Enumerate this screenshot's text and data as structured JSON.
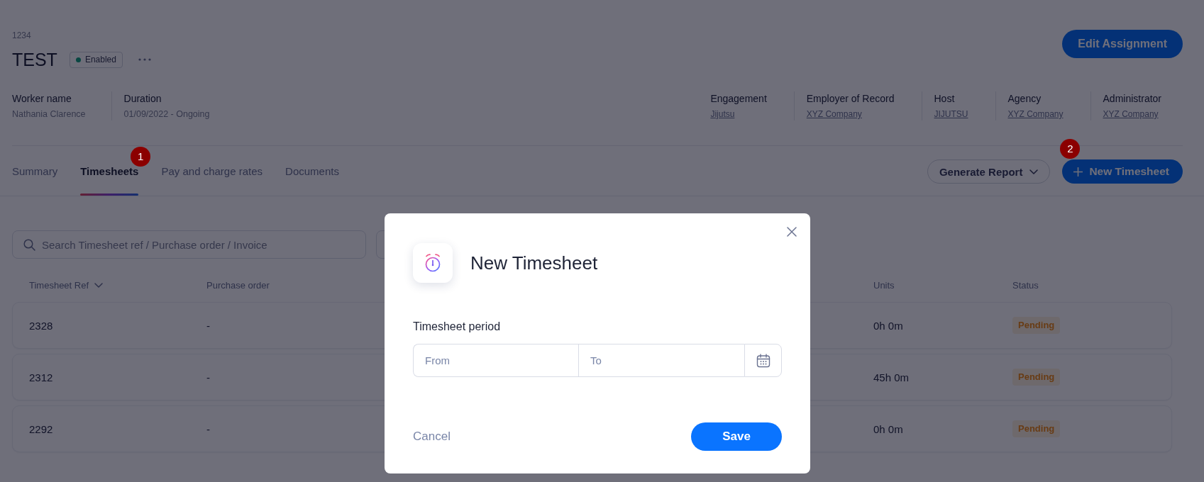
{
  "header": {
    "reference": "1234",
    "title": "TEST",
    "status": {
      "label": "Enabled",
      "on": true
    },
    "edit_button": "Edit Assignment"
  },
  "details": {
    "left": [
      {
        "label": "Worker name",
        "value": "Nathania Clarence",
        "kind": "text"
      },
      {
        "label": "Duration",
        "value": "01/09/2022 - Ongoing",
        "kind": "text"
      }
    ],
    "right": [
      {
        "label": "Engagement",
        "value": "Jijutsu",
        "kind": "link"
      },
      {
        "label": "Employer of Record",
        "value": "XYZ Company",
        "kind": "link"
      },
      {
        "label": "Host",
        "value": "JIJUTSU",
        "kind": "link"
      },
      {
        "label": "Agency",
        "value": "XYZ Company",
        "kind": "link"
      },
      {
        "label": "Administrator",
        "value": "XYZ Company",
        "kind": "link"
      }
    ]
  },
  "tabs": [
    {
      "label": "Summary",
      "selected": false
    },
    {
      "label": "Timesheets",
      "selected": true,
      "marker": "1"
    },
    {
      "label": "Pay and charge rates",
      "selected": false
    },
    {
      "label": "Documents",
      "selected": false
    }
  ],
  "actions": {
    "generate_report": "Generate Report",
    "new_timesheet": {
      "label": "New Timesheet",
      "marker": "2"
    }
  },
  "search": {
    "placeholder": "Search Timesheet ref / Purchase order / Invoice"
  },
  "table": {
    "columns": [
      {
        "label": "Timesheet Ref",
        "sorted": true
      },
      {
        "label": "Purchase order",
        "sorted": false
      },
      {
        "label": "Units",
        "sorted": false
      },
      {
        "label": "Status",
        "sorted": false
      }
    ],
    "rows": [
      {
        "ref": "2328",
        "purchase_order": "-",
        "units": "0h 0m",
        "status": {
          "label": "Pending",
          "kind": "pending"
        }
      },
      {
        "ref": "2312",
        "purchase_order": "-",
        "units": "45h 0m",
        "status": {
          "label": "Pending",
          "kind": "pending"
        }
      },
      {
        "ref": "2292",
        "purchase_order": "-",
        "units": "0h 0m",
        "status": {
          "label": "Pending",
          "kind": "pending"
        }
      }
    ]
  },
  "dialog": {
    "title": "New Timesheet",
    "field_label": "Timesheet period",
    "from": {
      "placeholder": "From"
    },
    "to": {
      "placeholder": "To"
    },
    "cancel": "Cancel",
    "save": "Save"
  }
}
